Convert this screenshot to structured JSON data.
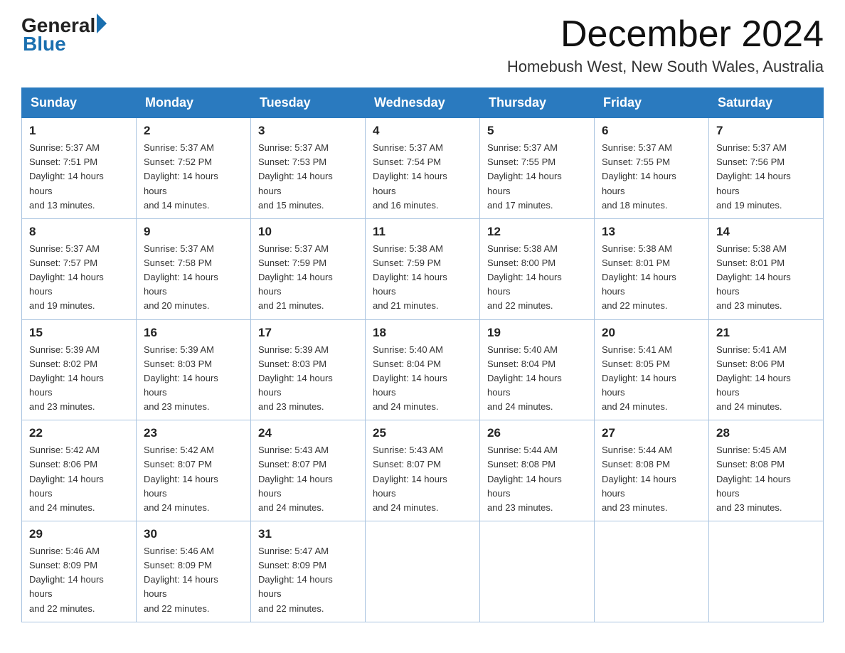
{
  "logo": {
    "text_general": "General",
    "arrow": "▶",
    "text_blue": "Blue"
  },
  "title": "December 2024",
  "subtitle": "Homebush West, New South Wales, Australia",
  "days_of_week": [
    "Sunday",
    "Monday",
    "Tuesday",
    "Wednesday",
    "Thursday",
    "Friday",
    "Saturday"
  ],
  "weeks": [
    [
      {
        "day": "1",
        "sunrise": "5:37 AM",
        "sunset": "7:51 PM",
        "daylight": "14 hours and 13 minutes."
      },
      {
        "day": "2",
        "sunrise": "5:37 AM",
        "sunset": "7:52 PM",
        "daylight": "14 hours and 14 minutes."
      },
      {
        "day": "3",
        "sunrise": "5:37 AM",
        "sunset": "7:53 PM",
        "daylight": "14 hours and 15 minutes."
      },
      {
        "day": "4",
        "sunrise": "5:37 AM",
        "sunset": "7:54 PM",
        "daylight": "14 hours and 16 minutes."
      },
      {
        "day": "5",
        "sunrise": "5:37 AM",
        "sunset": "7:55 PM",
        "daylight": "14 hours and 17 minutes."
      },
      {
        "day": "6",
        "sunrise": "5:37 AM",
        "sunset": "7:55 PM",
        "daylight": "14 hours and 18 minutes."
      },
      {
        "day": "7",
        "sunrise": "5:37 AM",
        "sunset": "7:56 PM",
        "daylight": "14 hours and 19 minutes."
      }
    ],
    [
      {
        "day": "8",
        "sunrise": "5:37 AM",
        "sunset": "7:57 PM",
        "daylight": "14 hours and 19 minutes."
      },
      {
        "day": "9",
        "sunrise": "5:37 AM",
        "sunset": "7:58 PM",
        "daylight": "14 hours and 20 minutes."
      },
      {
        "day": "10",
        "sunrise": "5:37 AM",
        "sunset": "7:59 PM",
        "daylight": "14 hours and 21 minutes."
      },
      {
        "day": "11",
        "sunrise": "5:38 AM",
        "sunset": "7:59 PM",
        "daylight": "14 hours and 21 minutes."
      },
      {
        "day": "12",
        "sunrise": "5:38 AM",
        "sunset": "8:00 PM",
        "daylight": "14 hours and 22 minutes."
      },
      {
        "day": "13",
        "sunrise": "5:38 AM",
        "sunset": "8:01 PM",
        "daylight": "14 hours and 22 minutes."
      },
      {
        "day": "14",
        "sunrise": "5:38 AM",
        "sunset": "8:01 PM",
        "daylight": "14 hours and 23 minutes."
      }
    ],
    [
      {
        "day": "15",
        "sunrise": "5:39 AM",
        "sunset": "8:02 PM",
        "daylight": "14 hours and 23 minutes."
      },
      {
        "day": "16",
        "sunrise": "5:39 AM",
        "sunset": "8:03 PM",
        "daylight": "14 hours and 23 minutes."
      },
      {
        "day": "17",
        "sunrise": "5:39 AM",
        "sunset": "8:03 PM",
        "daylight": "14 hours and 23 minutes."
      },
      {
        "day": "18",
        "sunrise": "5:40 AM",
        "sunset": "8:04 PM",
        "daylight": "14 hours and 24 minutes."
      },
      {
        "day": "19",
        "sunrise": "5:40 AM",
        "sunset": "8:04 PM",
        "daylight": "14 hours and 24 minutes."
      },
      {
        "day": "20",
        "sunrise": "5:41 AM",
        "sunset": "8:05 PM",
        "daylight": "14 hours and 24 minutes."
      },
      {
        "day": "21",
        "sunrise": "5:41 AM",
        "sunset": "8:06 PM",
        "daylight": "14 hours and 24 minutes."
      }
    ],
    [
      {
        "day": "22",
        "sunrise": "5:42 AM",
        "sunset": "8:06 PM",
        "daylight": "14 hours and 24 minutes."
      },
      {
        "day": "23",
        "sunrise": "5:42 AM",
        "sunset": "8:07 PM",
        "daylight": "14 hours and 24 minutes."
      },
      {
        "day": "24",
        "sunrise": "5:43 AM",
        "sunset": "8:07 PM",
        "daylight": "14 hours and 24 minutes."
      },
      {
        "day": "25",
        "sunrise": "5:43 AM",
        "sunset": "8:07 PM",
        "daylight": "14 hours and 24 minutes."
      },
      {
        "day": "26",
        "sunrise": "5:44 AM",
        "sunset": "8:08 PM",
        "daylight": "14 hours and 23 minutes."
      },
      {
        "day": "27",
        "sunrise": "5:44 AM",
        "sunset": "8:08 PM",
        "daylight": "14 hours and 23 minutes."
      },
      {
        "day": "28",
        "sunrise": "5:45 AM",
        "sunset": "8:08 PM",
        "daylight": "14 hours and 23 minutes."
      }
    ],
    [
      {
        "day": "29",
        "sunrise": "5:46 AM",
        "sunset": "8:09 PM",
        "daylight": "14 hours and 22 minutes."
      },
      {
        "day": "30",
        "sunrise": "5:46 AM",
        "sunset": "8:09 PM",
        "daylight": "14 hours and 22 minutes."
      },
      {
        "day": "31",
        "sunrise": "5:47 AM",
        "sunset": "8:09 PM",
        "daylight": "14 hours and 22 minutes."
      },
      null,
      null,
      null,
      null
    ]
  ],
  "labels": {
    "sunrise": "Sunrise:",
    "sunset": "Sunset:",
    "daylight": "Daylight:"
  }
}
